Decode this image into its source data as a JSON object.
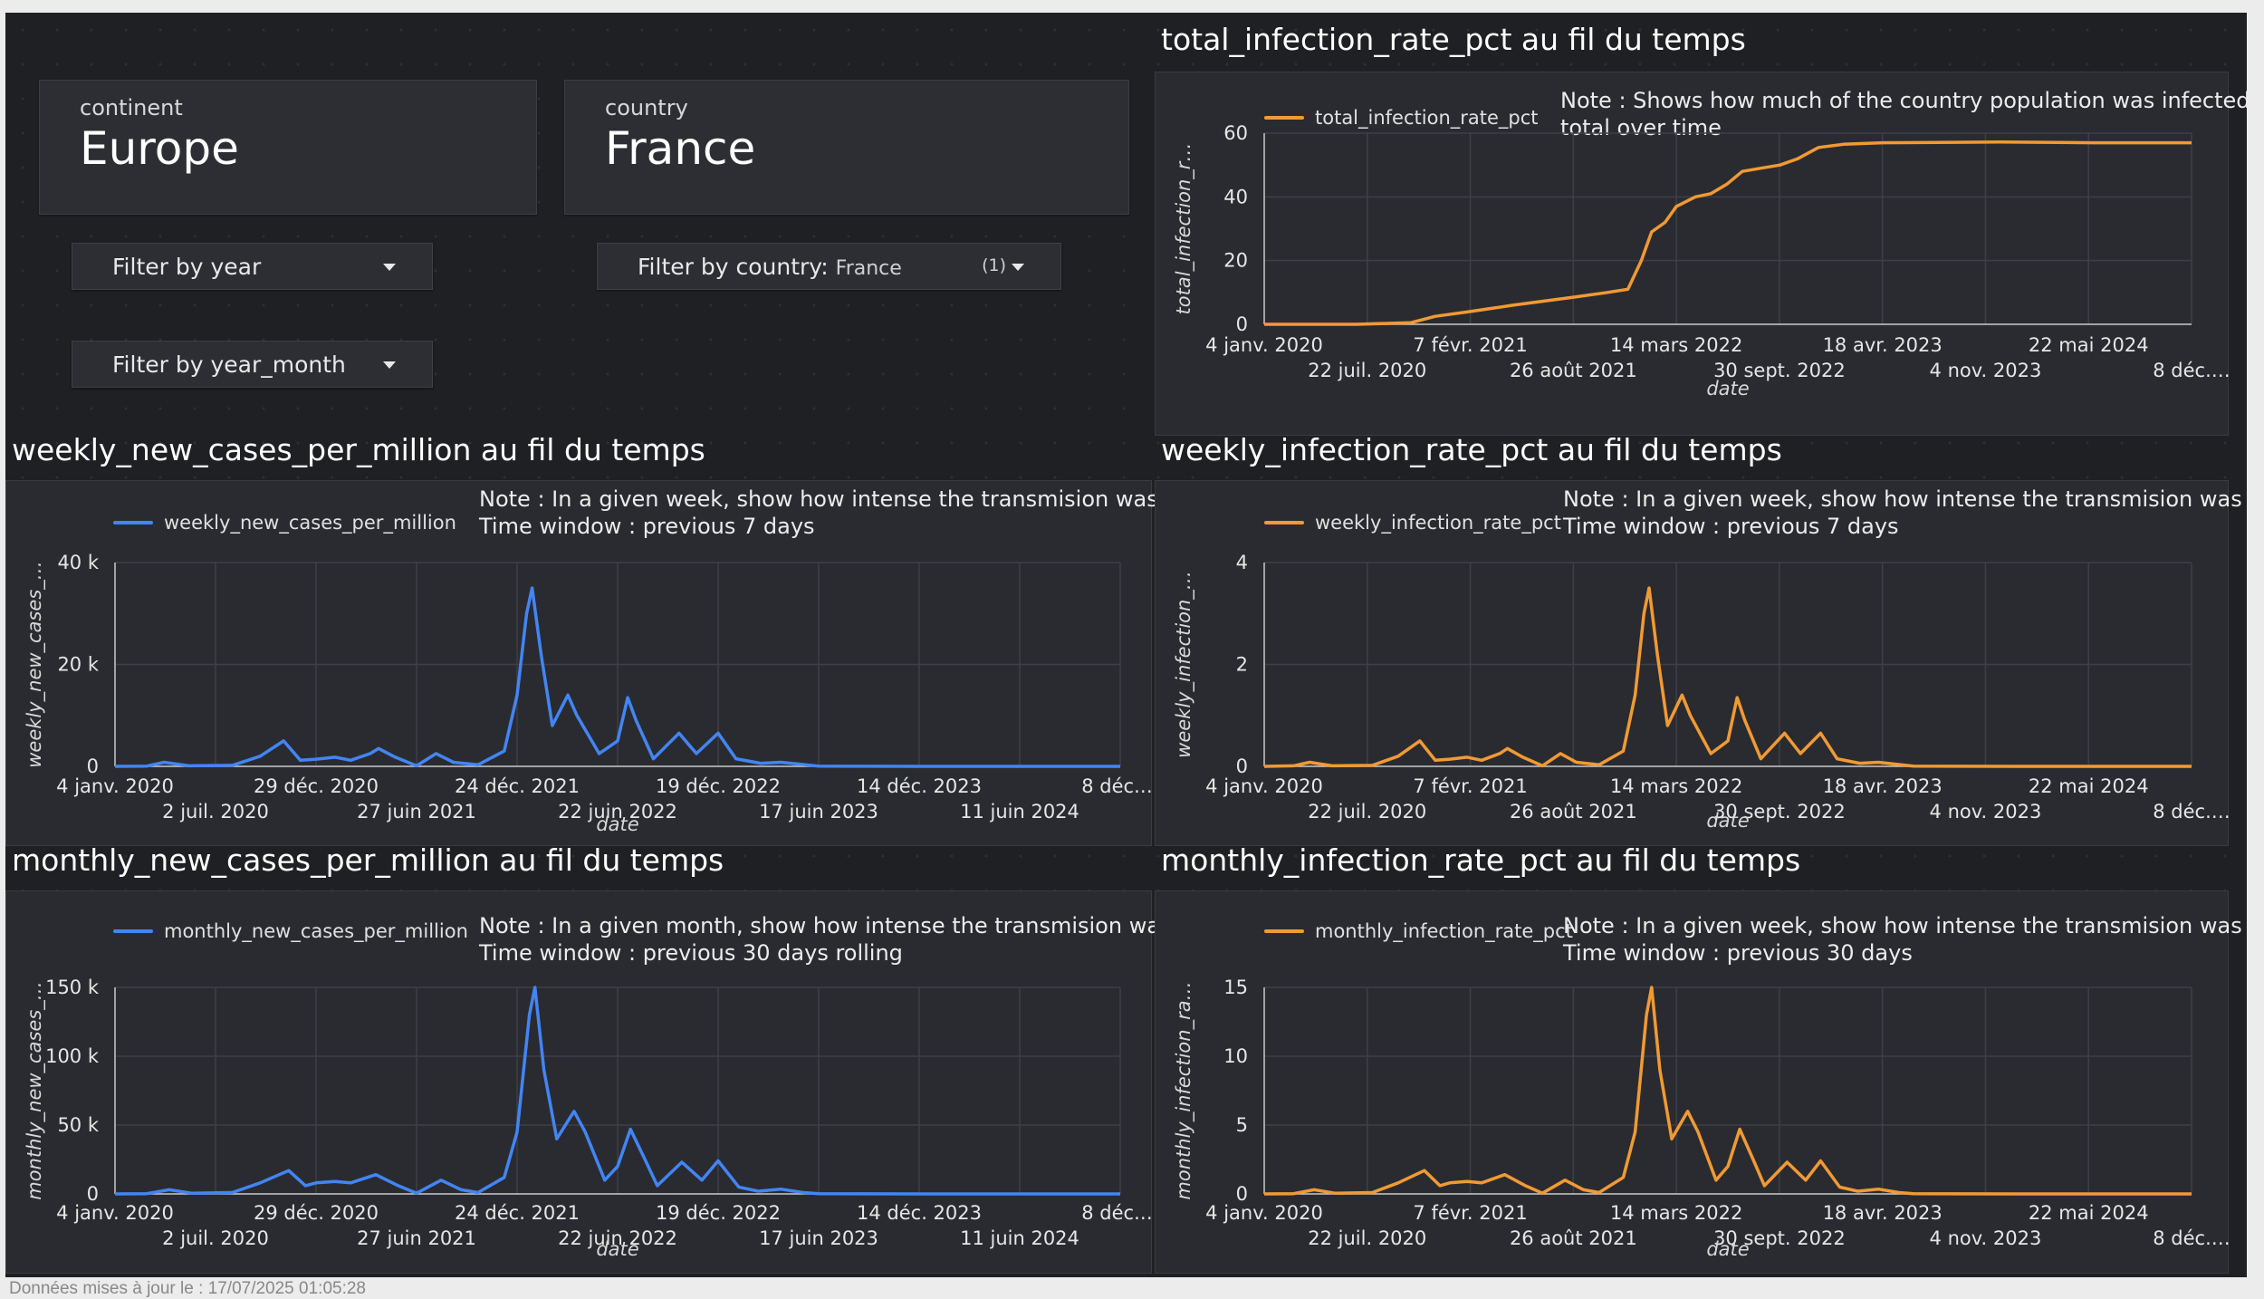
{
  "colors": {
    "blue": "#4285f4",
    "orange": "#f19a33"
  },
  "scorecards": [
    {
      "label": "continent",
      "value": "Europe"
    },
    {
      "label": "country",
      "value": "France"
    }
  ],
  "filters": {
    "year": {
      "label": "Filter by year"
    },
    "year_month": {
      "label": "Filter by year_month"
    },
    "country": {
      "label": "Filter by country:",
      "selected": "France",
      "count": "(1)"
    }
  },
  "footer": "Données mises à jour le : 17/07/2025 01:05:28",
  "chart_data": [
    {
      "id": "total",
      "type": "line",
      "title": "total_infection_rate_pct au fil du temps",
      "series": [
        {
          "name": "total_infection_rate_pct"
        }
      ],
      "note": [
        "Note : Shows how much of the country population was infected in",
        "total over time"
      ],
      "xlabel": "date",
      "ylabel": "total_infection_r…",
      "y_ticks": [
        "0",
        "20",
        "40",
        "60"
      ],
      "ylim": [
        0,
        60
      ],
      "x_ticks_row1": [
        "4 janv. 2020",
        "7 févr. 2021",
        "14 mars 2022",
        "18 avr. 2023",
        "22 mai 2024"
      ],
      "x_ticks_row2": [
        "22 juil. 2020",
        "26 août 2021",
        "30 sept. 2022",
        "4 nov. 2023",
        "8 déc.…"
      ],
      "xlim": [
        "2020-01-04",
        "2024-12-08"
      ],
      "color": "orange",
      "points": [
        [
          "2020-01-04",
          0
        ],
        [
          "2020-07-01",
          0
        ],
        [
          "2020-10-15",
          0.5
        ],
        [
          "2020-12-01",
          2.5
        ],
        [
          "2021-02-07",
          4
        ],
        [
          "2021-05-01",
          6
        ],
        [
          "2021-08-26",
          8.5
        ],
        [
          "2021-11-01",
          10
        ],
        [
          "2021-12-10",
          11
        ],
        [
          "2022-01-05",
          20
        ],
        [
          "2022-01-25",
          29
        ],
        [
          "2022-02-20",
          32
        ],
        [
          "2022-03-14",
          37
        ],
        [
          "2022-04-20",
          40
        ],
        [
          "2022-05-20",
          41
        ],
        [
          "2022-06-20",
          44
        ],
        [
          "2022-07-20",
          48
        ],
        [
          "2022-08-25",
          49
        ],
        [
          "2022-10-01",
          50
        ],
        [
          "2022-11-05",
          52
        ],
        [
          "2022-12-15",
          55.5
        ],
        [
          "2023-02-01",
          56.5
        ],
        [
          "2023-04-18",
          57
        ],
        [
          "2023-12-01",
          57.2
        ],
        [
          "2024-06-01",
          57
        ],
        [
          "2024-12-08",
          57
        ]
      ]
    },
    {
      "id": "weekly_cases",
      "type": "line",
      "title": "weekly_new_cases_per_million au fil du temps",
      "series": [
        {
          "name": "weekly_new_cases_per_million"
        }
      ],
      "note": [
        "Note :  In a given week, show how intense the transmision was",
        "Time window : previous 7 days"
      ],
      "xlabel": "date",
      "ylabel": "weekly_new_cases_…",
      "y_ticks": [
        "0",
        "20 k",
        "40 k"
      ],
      "ylim": [
        0,
        40000
      ],
      "x_ticks_row1": [
        "4 janv. 2020",
        "29 déc. 2020",
        "24 déc. 2021",
        "19 déc. 2022",
        "14 déc. 2023",
        "8 déc.…"
      ],
      "x_ticks_row2": [
        "2 juil. 2020",
        "27 juin 2021",
        "22 juin 2022",
        "17 juin 2023",
        "11 juin 2024"
      ],
      "xlim": [
        "2020-01-04",
        "2024-12-08"
      ],
      "color": "blue",
      "points": [
        [
          "2020-01-04",
          0
        ],
        [
          "2020-03-01",
          50
        ],
        [
          "2020-04-01",
          800
        ],
        [
          "2020-05-15",
          100
        ],
        [
          "2020-08-01",
          200
        ],
        [
          "2020-09-20",
          2000
        ],
        [
          "2020-11-01",
          5000
        ],
        [
          "2020-12-01",
          1200
        ],
        [
          "2020-12-29",
          1400
        ],
        [
          "2021-02-01",
          1800
        ],
        [
          "2021-03-01",
          1200
        ],
        [
          "2021-04-05",
          2500
        ],
        [
          "2021-04-20",
          3500
        ],
        [
          "2021-05-20",
          1800
        ],
        [
          "2021-06-27",
          100
        ],
        [
          "2021-08-01",
          2500
        ],
        [
          "2021-09-01",
          800
        ],
        [
          "2021-10-15",
          300
        ],
        [
          "2021-12-01",
          3000
        ],
        [
          "2021-12-24",
          14000
        ],
        [
          "2022-01-10",
          30000
        ],
        [
          "2022-01-20",
          35000
        ],
        [
          "2022-02-05",
          22000
        ],
        [
          "2022-02-25",
          8000
        ],
        [
          "2022-03-25",
          14000
        ],
        [
          "2022-04-10",
          10000
        ],
        [
          "2022-05-20",
          2500
        ],
        [
          "2022-06-22",
          5000
        ],
        [
          "2022-07-10",
          13500
        ],
        [
          "2022-07-25",
          9000
        ],
        [
          "2022-08-25",
          1500
        ],
        [
          "2022-10-10",
          6500
        ],
        [
          "2022-11-10",
          2500
        ],
        [
          "2022-12-19",
          6500
        ],
        [
          "2023-01-20",
          1500
        ],
        [
          "2023-03-05",
          600
        ],
        [
          "2023-04-10",
          800
        ],
        [
          "2023-06-17",
          50
        ],
        [
          "2024-01-01",
          0
        ],
        [
          "2024-12-08",
          0
        ]
      ]
    },
    {
      "id": "weekly_rate",
      "type": "line",
      "title": "weekly_infection_rate_pct au fil du temps",
      "series": [
        {
          "name": "weekly_infection_rate_pct"
        }
      ],
      "note": [
        "Note :  In a given week, show how intense the transmision was",
        "Time window : previous 7 days"
      ],
      "xlabel": "date",
      "ylabel": "weekly_infection_…",
      "y_ticks": [
        "0",
        "2",
        "4"
      ],
      "ylim": [
        0,
        4
      ],
      "x_ticks_row1": [
        "4 janv. 2020",
        "7 févr. 2021",
        "14 mars 2022",
        "18 avr. 2023",
        "22 mai 2024"
      ],
      "x_ticks_row2": [
        "22 juil. 2020",
        "26 août 2021",
        "30 sept. 2022",
        "4 nov. 2023",
        "8 déc.…"
      ],
      "xlim": [
        "2020-01-04",
        "2024-12-08"
      ],
      "color": "orange",
      "points": [
        [
          "2020-01-04",
          0
        ],
        [
          "2020-03-01",
          0.01
        ],
        [
          "2020-04-01",
          0.08
        ],
        [
          "2020-05-15",
          0.01
        ],
        [
          "2020-08-01",
          0.02
        ],
        [
          "2020-09-20",
          0.2
        ],
        [
          "2020-11-01",
          0.5
        ],
        [
          "2020-12-01",
          0.12
        ],
        [
          "2020-12-29",
          0.14
        ],
        [
          "2021-02-01",
          0.18
        ],
        [
          "2021-03-01",
          0.12
        ],
        [
          "2021-04-05",
          0.25
        ],
        [
          "2021-04-20",
          0.35
        ],
        [
          "2021-05-20",
          0.18
        ],
        [
          "2021-06-27",
          0.01
        ],
        [
          "2021-08-01",
          0.25
        ],
        [
          "2021-09-01",
          0.08
        ],
        [
          "2021-10-15",
          0.03
        ],
        [
          "2021-12-01",
          0.3
        ],
        [
          "2021-12-24",
          1.4
        ],
        [
          "2022-01-10",
          3.0
        ],
        [
          "2022-01-20",
          3.5
        ],
        [
          "2022-02-05",
          2.2
        ],
        [
          "2022-02-25",
          0.8
        ],
        [
          "2022-03-25",
          1.4
        ],
        [
          "2022-04-10",
          1.0
        ],
        [
          "2022-05-20",
          0.25
        ],
        [
          "2022-06-22",
          0.5
        ],
        [
          "2022-07-10",
          1.35
        ],
        [
          "2022-07-25",
          0.9
        ],
        [
          "2022-08-25",
          0.15
        ],
        [
          "2022-10-10",
          0.65
        ],
        [
          "2022-11-10",
          0.25
        ],
        [
          "2022-12-19",
          0.65
        ],
        [
          "2023-01-20",
          0.15
        ],
        [
          "2023-03-05",
          0.06
        ],
        [
          "2023-04-10",
          0.08
        ],
        [
          "2023-06-17",
          0.005
        ],
        [
          "2024-01-01",
          0
        ],
        [
          "2024-12-08",
          0
        ]
      ]
    },
    {
      "id": "monthly_cases",
      "type": "line",
      "title": "monthly_new_cases_per_million au fil du temps",
      "series": [
        {
          "name": "monthly_new_cases_per_million"
        }
      ],
      "note": [
        "Note :  In a given month, show how intense the transmision was",
        "Time window : previous 30 days rolling"
      ],
      "xlabel": "date",
      "ylabel": "monthly_new_cases_…",
      "y_ticks": [
        "0",
        "50 k",
        "100 k",
        "150 k"
      ],
      "ylim": [
        0,
        150000
      ],
      "x_ticks_row1": [
        "4 janv. 2020",
        "29 déc. 2020",
        "24 déc. 2021",
        "19 déc. 2022",
        "14 déc. 2023",
        "8 déc.…"
      ],
      "x_ticks_row2": [
        "2 juil. 2020",
        "27 juin 2021",
        "22 juin 2022",
        "17 juin 2023",
        "11 juin 2024"
      ],
      "xlim": [
        "2020-01-04",
        "2024-12-08"
      ],
      "color": "blue",
      "points": [
        [
          "2020-01-04",
          0
        ],
        [
          "2020-03-01",
          200
        ],
        [
          "2020-04-10",
          3000
        ],
        [
          "2020-05-20",
          500
        ],
        [
          "2020-08-01",
          1000
        ],
        [
          "2020-09-20",
          8000
        ],
        [
          "2020-11-10",
          17000
        ],
        [
          "2020-12-10",
          6000
        ],
        [
          "2020-12-29",
          8000
        ],
        [
          "2021-02-01",
          9000
        ],
        [
          "2021-03-01",
          8000
        ],
        [
          "2021-04-15",
          14000
        ],
        [
          "2021-05-25",
          6000
        ],
        [
          "2021-06-27",
          500
        ],
        [
          "2021-08-10",
          10000
        ],
        [
          "2021-09-15",
          3000
        ],
        [
          "2021-10-15",
          1000
        ],
        [
          "2021-12-01",
          12000
        ],
        [
          "2021-12-24",
          45000
        ],
        [
          "2022-01-15",
          130000
        ],
        [
          "2022-01-25",
          150000
        ],
        [
          "2022-02-10",
          90000
        ],
        [
          "2022-03-05",
          40000
        ],
        [
          "2022-04-05",
          60000
        ],
        [
          "2022-04-25",
          45000
        ],
        [
          "2022-05-30",
          10000
        ],
        [
          "2022-06-22",
          20000
        ],
        [
          "2022-07-15",
          47000
        ],
        [
          "2022-08-10",
          25000
        ],
        [
          "2022-09-01",
          6000
        ],
        [
          "2022-10-15",
          23000
        ],
        [
          "2022-11-20",
          10000
        ],
        [
          "2022-12-19",
          24000
        ],
        [
          "2023-01-25",
          5000
        ],
        [
          "2023-03-01",
          2000
        ],
        [
          "2023-04-10",
          3500
        ],
        [
          "2023-05-20",
          1000
        ],
        [
          "2023-06-17",
          200
        ],
        [
          "2024-01-01",
          0
        ],
        [
          "2024-12-08",
          0
        ]
      ]
    },
    {
      "id": "monthly_rate",
      "type": "line",
      "title": "monthly_infection_rate_pct au fil du temps",
      "series": [
        {
          "name": "monthly_infection_rate_pct"
        }
      ],
      "note": [
        "Note :  In a given week, show how intense the transmision was",
        "Time window : previous 30 days"
      ],
      "xlabel": "date",
      "ylabel": "monthly_infection_ra…",
      "y_ticks": [
        "0",
        "5",
        "10",
        "15"
      ],
      "ylim": [
        0,
        15
      ],
      "x_ticks_row1": [
        "4 janv. 2020",
        "7 févr. 2021",
        "14 mars 2022",
        "18 avr. 2023",
        "22 mai 2024"
      ],
      "x_ticks_row2": [
        "22 juil. 2020",
        "26 août 2021",
        "30 sept. 2022",
        "4 nov. 2023",
        "8 déc.…"
      ],
      "xlim": [
        "2020-01-04",
        "2024-12-08"
      ],
      "color": "orange",
      "points": [
        [
          "2020-01-04",
          0
        ],
        [
          "2020-03-01",
          0.02
        ],
        [
          "2020-04-10",
          0.3
        ],
        [
          "2020-05-20",
          0.05
        ],
        [
          "2020-08-01",
          0.1
        ],
        [
          "2020-09-20",
          0.8
        ],
        [
          "2020-11-10",
          1.7
        ],
        [
          "2020-12-10",
          0.6
        ],
        [
          "2020-12-29",
          0.8
        ],
        [
          "2021-02-01",
          0.9
        ],
        [
          "2021-03-01",
          0.8
        ],
        [
          "2021-04-15",
          1.4
        ],
        [
          "2021-05-25",
          0.6
        ],
        [
          "2021-06-27",
          0.05
        ],
        [
          "2021-08-10",
          1.0
        ],
        [
          "2021-09-15",
          0.3
        ],
        [
          "2021-10-15",
          0.1
        ],
        [
          "2021-12-01",
          1.2
        ],
        [
          "2021-12-24",
          4.5
        ],
        [
          "2022-01-15",
          13
        ],
        [
          "2022-01-25",
          15
        ],
        [
          "2022-02-10",
          9
        ],
        [
          "2022-03-05",
          4
        ],
        [
          "2022-04-05",
          6
        ],
        [
          "2022-04-25",
          4.5
        ],
        [
          "2022-05-30",
          1.0
        ],
        [
          "2022-06-22",
          2.0
        ],
        [
          "2022-07-15",
          4.7
        ],
        [
          "2022-08-10",
          2.5
        ],
        [
          "2022-09-01",
          0.6
        ],
        [
          "2022-10-15",
          2.3
        ],
        [
          "2022-11-20",
          1.0
        ],
        [
          "2022-12-19",
          2.4
        ],
        [
          "2023-01-25",
          0.5
        ],
        [
          "2023-03-01",
          0.2
        ],
        [
          "2023-04-10",
          0.35
        ],
        [
          "2023-05-20",
          0.1
        ],
        [
          "2023-06-17",
          0.02
        ],
        [
          "2024-01-01",
          0
        ],
        [
          "2024-12-08",
          0
        ]
      ]
    }
  ]
}
